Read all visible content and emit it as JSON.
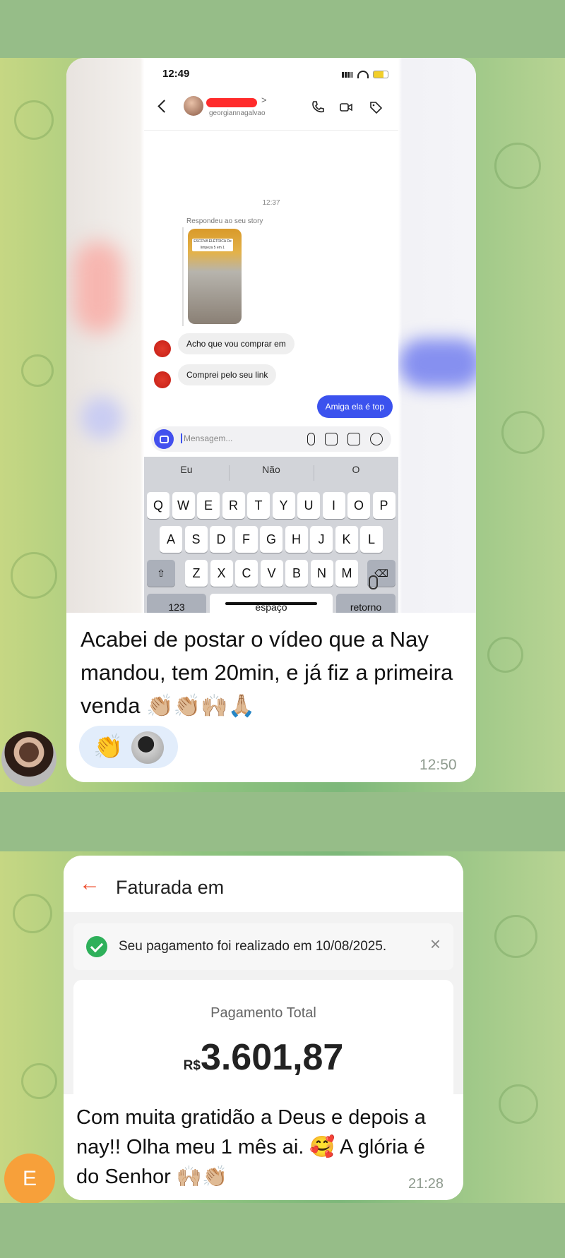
{
  "message1": {
    "screenshot": {
      "status_time": "12:49",
      "username": "georgiannagalvao",
      "chevron": ">",
      "timestamp": "12:37",
      "replied_label": "Respondeu ao seu story",
      "story_tag": "ESCOVA ELÉTRICA De limpeza 5 em 1",
      "incoming": [
        "Acho que vou comprar em",
        "Comprei pelo seu link"
      ],
      "outgoing": "Amiga ela é top",
      "compose_placeholder": "Mensagem...",
      "suggestions": [
        "Eu",
        "Não",
        "O"
      ],
      "keys_row1": [
        "Q",
        "W",
        "E",
        "R",
        "T",
        "Y",
        "U",
        "I",
        "O",
        "P"
      ],
      "keys_row2": [
        "A",
        "S",
        "D",
        "F",
        "G",
        "H",
        "J",
        "K",
        "L"
      ],
      "keys_row3": [
        "Z",
        "X",
        "C",
        "V",
        "B",
        "N",
        "M"
      ],
      "key_numbers": "123",
      "key_space": "espaço",
      "key_return": "retorno"
    },
    "caption": "Acabei de postar o vídeo que a Nay mandou, tem 20min, e já fiz a primeira venda 👏🏼👏🏼🙌🏼🙏🏼",
    "reaction": "👏",
    "time": "12:50"
  },
  "message2": {
    "screenshot": {
      "back_arrow": "←",
      "title": "Faturada em",
      "notice": "Seu pagamento foi realizado em 10/08/2025.",
      "close": "×",
      "total_label": "Pagamento Total",
      "currency": "R$",
      "amount": "3.601,87"
    },
    "caption": "Com muita gratidão a Deus e depois a nay!! Olha meu 1 mês ai. 🥰 A glória é do Senhor 🙌🏼👏🏼",
    "time": "21:28",
    "avatar_initial": "E",
    "avatar_color": "#f7a03a"
  },
  "colors": {
    "page_bg": "#96bd88",
    "bubble": "#ffffff",
    "outgoing_blue": "#3b52ee",
    "shopee_orange": "#ee4d2d",
    "success_green": "#2eb05a"
  }
}
